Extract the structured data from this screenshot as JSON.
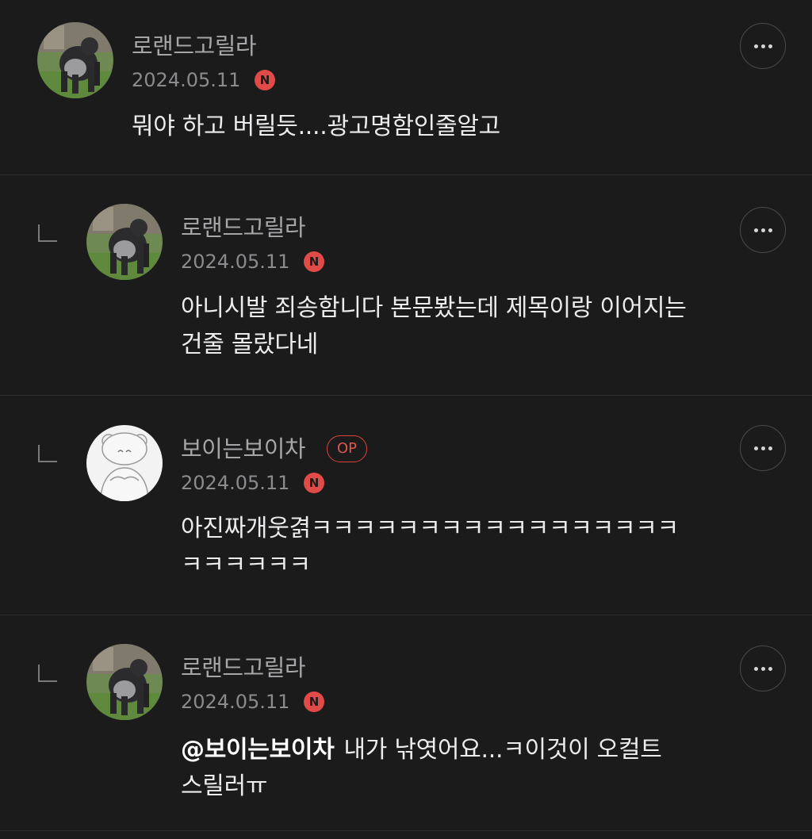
{
  "comments": [
    {
      "author": "로랜드고릴라",
      "date": "2024.05.11",
      "badge": "N",
      "body": "뭐야 하고 버릴듯....광고명함인줄알고",
      "avatar_icon": "gorilla-avatar",
      "is_reply": false
    },
    {
      "author": "로랜드고릴라",
      "date": "2024.05.11",
      "badge": "N",
      "body": "아니시발 죄송함니다 본문봤는데 제목이랑 이어지는\n건줄 몰랐다네",
      "avatar_icon": "gorilla-avatar",
      "is_reply": true
    },
    {
      "author": "보이는보이차",
      "op_label": "OP",
      "date": "2024.05.11",
      "badge": "N",
      "body": "아진짜개웃겱ㅋㅋㅋㅋㅋㅋㅋㅋㅋㅋㅋㅋㅋㅋㅋㅋㅋ\nㅋㅋㅋㅋㅋㅋ",
      "avatar_icon": "cartoon-bear-avatar",
      "is_reply": true
    },
    {
      "author": "로랜드고릴라",
      "date": "2024.05.11",
      "badge": "N",
      "mention": "@보이는보이차",
      "body": "내가 낚엿어요...ㅋ이것이 오컬트\n스릴러ㅠ",
      "avatar_icon": "gorilla-avatar",
      "is_reply": true
    }
  ],
  "icons": {
    "more": "more-horizontal-icon",
    "reply": "reply-arrow-icon",
    "new": "new-badge-icon"
  },
  "colors": {
    "background": "#1b1b1c",
    "new_badge": "#e04a47",
    "op_badge": "#d9453e",
    "divider": "#2e2e30"
  }
}
